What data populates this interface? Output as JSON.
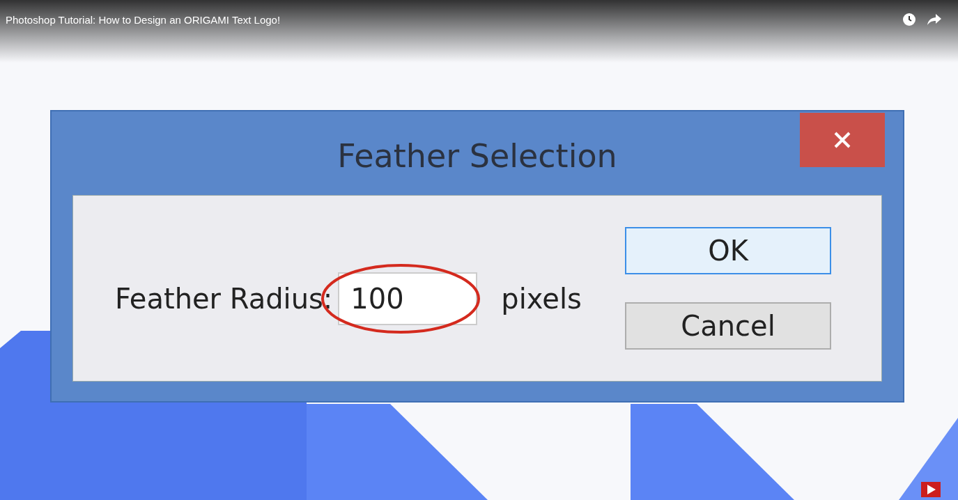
{
  "video_title": "Photoshop Tutorial: How to Design an ORIGAMI Text Logo!",
  "dialog": {
    "title": "Feather Selection",
    "field": {
      "label": "Feather Radius:",
      "value": "100"
    },
    "unit": "pixels",
    "buttons": [
      {
        "label": "OK",
        "focused": true
      },
      {
        "label": "Cancel",
        "focused": false
      }
    ]
  }
}
